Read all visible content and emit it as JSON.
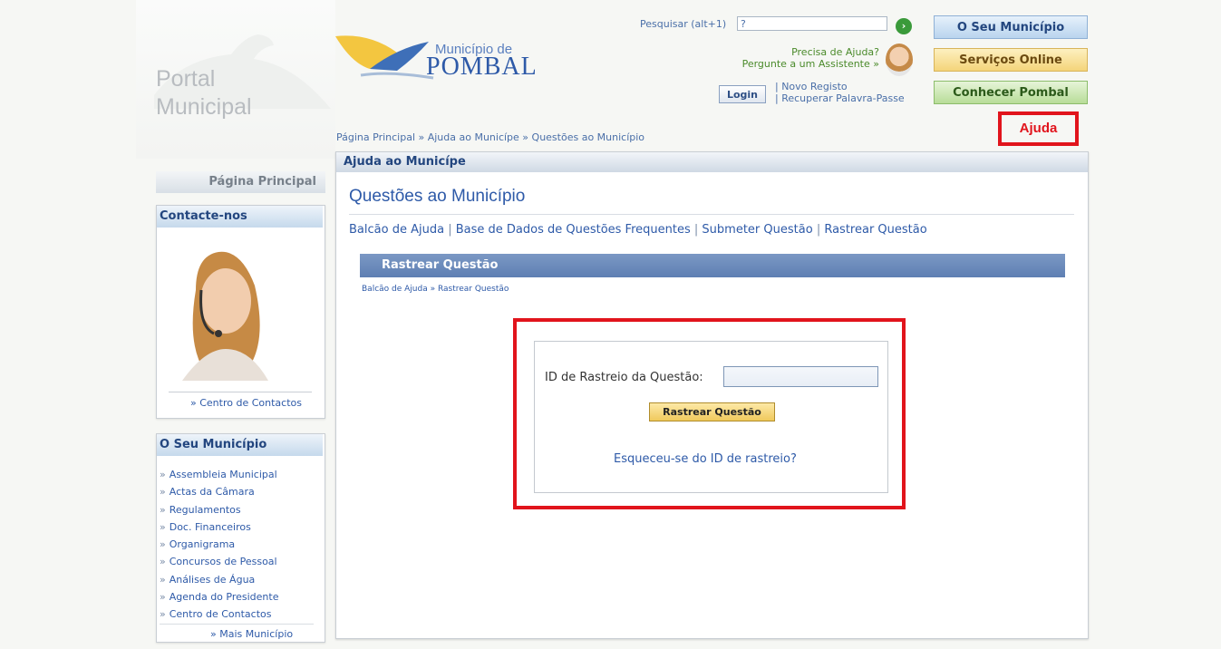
{
  "header": {
    "portal_title_line1": "Portal",
    "portal_title_line2": "Municipal",
    "logo_line1": "Município de",
    "logo_line2": "POMBAL",
    "search_label": "Pesquisar (alt+1)",
    "search_value": "?",
    "help_line1": "Precisa de Ajuda?",
    "help_line2": "Pergunte a um Assistente »",
    "login_label": "Login",
    "new_register": "| Novo Registo",
    "recover_password": "| Recuperar Palavra-Passe",
    "btn_municipio": "O Seu Município",
    "btn_servicos": "Serviços Online",
    "btn_conhecer": "Conhecer Pombal",
    "ajuda_label": "Ajuda"
  },
  "breadcrumb": "Página Principal » Ajuda ao Municípe » Questões ao Município",
  "main": {
    "panel_title": "Ajuda ao Municípe",
    "page_title": "Questões ao Município",
    "nav": {
      "help_desk": "Balcão de Ajuda",
      "faq": "Base de Dados de Questões Frequentes",
      "submit": "Submeter Questão",
      "track": "Rastrear Questão",
      "separator": "|"
    },
    "band_title": "Rastrear Questão",
    "sub_breadcrumb": "Balcão de Ajuda » Rastrear Questão",
    "form": {
      "label": "ID de Rastreio da Questão:",
      "value": "",
      "submit_label": "Rastrear Questão",
      "forgot_link": "Esqueceu-se do ID de rastreio?"
    }
  },
  "sidebar": {
    "home_label": "Página Principal",
    "contact_title": "Contacte-nos",
    "contact_link": "» Centro de Contactos",
    "municipio_title": "O Seu Município",
    "chevron": "»",
    "municipio_items": [
      "Assembleia Municipal",
      "Actas da Câmara",
      "Regulamentos",
      "Doc. Financeiros",
      "Organigrama",
      "Concursos de Pessoal",
      "Análises de Água",
      "Agenda do Presidente",
      "Centro de Contactos"
    ],
    "more_link": "» Mais Município"
  },
  "colors": {
    "accent_blue": "#2e5aa8",
    "highlight_red": "#e1141c",
    "band_blue": "#6a89ba"
  }
}
